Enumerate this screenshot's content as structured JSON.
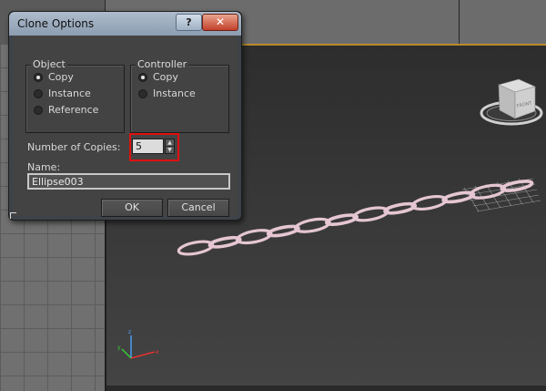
{
  "dialog": {
    "title": "Clone Options",
    "help_label": "?",
    "close_label": "✕",
    "object_group": {
      "label": "Object",
      "options": [
        {
          "label": "Copy",
          "selected": true
        },
        {
          "label": "Instance",
          "selected": false
        },
        {
          "label": "Reference",
          "selected": false
        }
      ]
    },
    "controller_group": {
      "label": "Controller",
      "options": [
        {
          "label": "Copy",
          "selected": true
        },
        {
          "label": "Instance",
          "selected": false
        }
      ]
    },
    "copies_label": "Number of Copies:",
    "copies_value": "5",
    "name_label": "Name:",
    "name_value": "Ellipse003",
    "ok_label": "OK",
    "cancel_label": "Cancel"
  },
  "viewcube": {
    "face_label": "FRONT"
  },
  "colors": {
    "highlight": "#e01010",
    "chain": "#e5c6d2",
    "titlebar": "#9aabbe",
    "selection_box": "#b88a2a"
  },
  "icons": [
    "help-icon",
    "close-icon",
    "spinner-up-icon",
    "spinner-down-icon",
    "axis-tripod-icon",
    "viewcube-icon"
  ]
}
